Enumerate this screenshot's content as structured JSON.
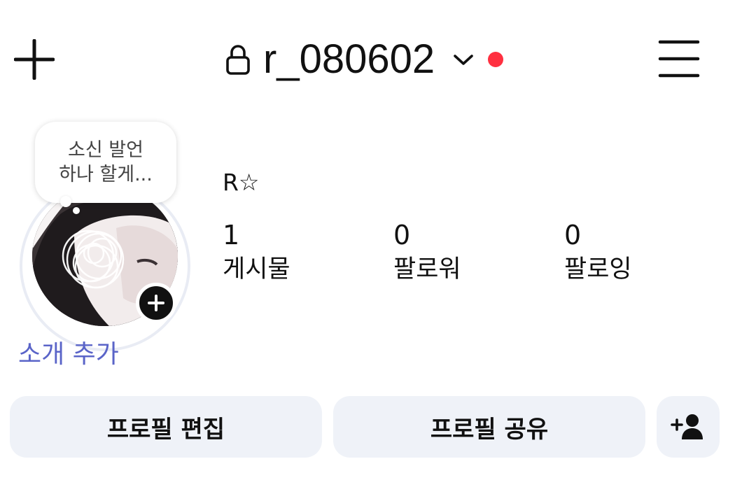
{
  "header": {
    "username": "r_080602",
    "notification_color": "#ff3040",
    "icons": [
      "plus-icon",
      "lock-icon",
      "chevron-down-icon",
      "menu-icon"
    ]
  },
  "profile": {
    "note_line1": "소신 발언",
    "note_line2": "하나 할게...",
    "add_bio": "소개 추가",
    "display_name": "R☆",
    "link_color": "#5a64c8"
  },
  "stats": [
    {
      "count": "1",
      "label": "게시물"
    },
    {
      "count": "0",
      "label": "팔로워"
    },
    {
      "count": "0",
      "label": "팔로잉"
    }
  ],
  "actions": {
    "edit_profile": "프로필 편집",
    "share_profile": "프로필 공유",
    "discover_icon": "add-person-icon"
  }
}
